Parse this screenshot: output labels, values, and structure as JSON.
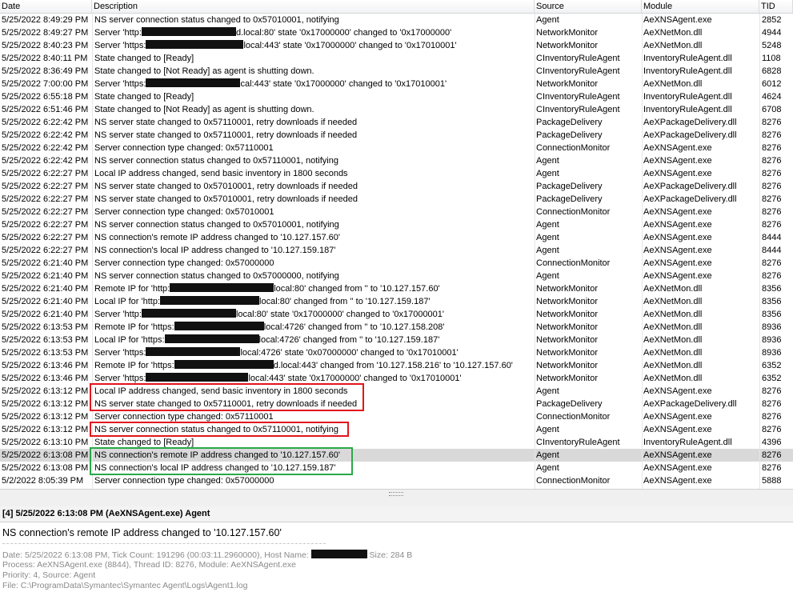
{
  "columns": {
    "date": "Date",
    "description": "Description",
    "source": "Source",
    "module": "Module",
    "tid": "TID"
  },
  "rows": [
    {
      "date": "5/25/2022 8:49:29 PM",
      "desc": [
        "NS server connection status changed to 0x57010001, notifying"
      ],
      "source": "Agent",
      "module": "AeXNSAgent.exe",
      "tid": "2852"
    },
    {
      "date": "5/25/2022 8:49:27 PM",
      "desc": [
        "Server 'http:",
        "#R#118",
        "d.local:80' state '0x17000000' changed to '0x17000000'"
      ],
      "source": "NetworkMonitor",
      "module": "AeXNetMon.dll",
      "tid": "4944"
    },
    {
      "date": "5/25/2022 8:40:23 PM",
      "desc": [
        "Server 'https:",
        "#R#122",
        "local:443' state '0x17000000' changed to '0x17010001'"
      ],
      "source": "NetworkMonitor",
      "module": "AeXNetMon.dll",
      "tid": "5248"
    },
    {
      "date": "5/25/2022 8:40:11 PM",
      "desc": [
        "State changed to [Ready]"
      ],
      "source": "CInventoryRuleAgent",
      "module": "InventoryRuleAgent.dll",
      "tid": "1108"
    },
    {
      "date": "5/25/2022 8:36:49 PM",
      "desc": [
        "State changed to [Not Ready] as agent is shutting down."
      ],
      "source": "CInventoryRuleAgent",
      "module": "InventoryRuleAgent.dll",
      "tid": "6828"
    },
    {
      "date": "5/25/2022 7:00:00 PM",
      "desc": [
        "Server 'https:",
        "#R#118",
        "cal:443' state '0x17000000' changed to '0x17010001'"
      ],
      "source": "NetworkMonitor",
      "module": "AeXNetMon.dll",
      "tid": "6012"
    },
    {
      "date": "5/25/2022 6:55:18 PM",
      "desc": [
        "State changed to [Ready]"
      ],
      "source": "CInventoryRuleAgent",
      "module": "InventoryRuleAgent.dll",
      "tid": "4624"
    },
    {
      "date": "5/25/2022 6:51:46 PM",
      "desc": [
        "State changed to [Not Ready] as agent is shutting down."
      ],
      "source": "CInventoryRuleAgent",
      "module": "InventoryRuleAgent.dll",
      "tid": "6708"
    },
    {
      "date": "5/25/2022 6:22:42 PM",
      "desc": [
        "NS server state changed to 0x57110001, retry downloads if needed"
      ],
      "source": "PackageDelivery",
      "module": "AeXPackageDelivery.dll",
      "tid": "8276"
    },
    {
      "date": "5/25/2022 6:22:42 PM",
      "desc": [
        "NS server state changed to 0x57110001, retry downloads if needed"
      ],
      "source": "PackageDelivery",
      "module": "AeXPackageDelivery.dll",
      "tid": "8276"
    },
    {
      "date": "5/25/2022 6:22:42 PM",
      "desc": [
        "Server connection type changed: 0x57110001"
      ],
      "source": "ConnectionMonitor",
      "module": "AeXNSAgent.exe",
      "tid": "8276"
    },
    {
      "date": "5/25/2022 6:22:42 PM",
      "desc": [
        "NS server connection status changed to 0x57110001, notifying"
      ],
      "source": "Agent",
      "module": "AeXNSAgent.exe",
      "tid": "8276"
    },
    {
      "date": "5/25/2022 6:22:27 PM",
      "desc": [
        "Local IP address changed, send basic inventory in 1800 seconds"
      ],
      "source": "Agent",
      "module": "AeXNSAgent.exe",
      "tid": "8276"
    },
    {
      "date": "5/25/2022 6:22:27 PM",
      "desc": [
        "NS server state changed to 0x57010001, retry downloads if needed"
      ],
      "source": "PackageDelivery",
      "module": "AeXPackageDelivery.dll",
      "tid": "8276"
    },
    {
      "date": "5/25/2022 6:22:27 PM",
      "desc": [
        "NS server state changed to 0x57010001, retry downloads if needed"
      ],
      "source": "PackageDelivery",
      "module": "AeXPackageDelivery.dll",
      "tid": "8276"
    },
    {
      "date": "5/25/2022 6:22:27 PM",
      "desc": [
        "Server connection type changed: 0x57010001"
      ],
      "source": "ConnectionMonitor",
      "module": "AeXNSAgent.exe",
      "tid": "8276"
    },
    {
      "date": "5/25/2022 6:22:27 PM",
      "desc": [
        "NS server connection status changed to 0x57010001, notifying"
      ],
      "source": "Agent",
      "module": "AeXNSAgent.exe",
      "tid": "8276"
    },
    {
      "date": "5/25/2022 6:22:27 PM",
      "desc": [
        "NS connection's remote IP address changed to '10.127.157.60'"
      ],
      "source": "Agent",
      "module": "AeXNSAgent.exe",
      "tid": "8444"
    },
    {
      "date": "5/25/2022 6:22:27 PM",
      "desc": [
        "NS connection's local IP address changed to '10.127.159.187'"
      ],
      "source": "Agent",
      "module": "AeXNSAgent.exe",
      "tid": "8444"
    },
    {
      "date": "5/25/2022 6:21:40 PM",
      "desc": [
        "Server connection type changed: 0x57000000"
      ],
      "source": "ConnectionMonitor",
      "module": "AeXNSAgent.exe",
      "tid": "8276"
    },
    {
      "date": "5/25/2022 6:21:40 PM",
      "desc": [
        "NS server connection status changed to 0x57000000, notifying"
      ],
      "source": "Agent",
      "module": "AeXNSAgent.exe",
      "tid": "8276"
    },
    {
      "date": "5/25/2022 6:21:40 PM",
      "desc": [
        "Remote IP for 'http:",
        "#R#130",
        "local:80' changed from '' to '10.127.157.60'"
      ],
      "source": "NetworkMonitor",
      "module": "AeXNetMon.dll",
      "tid": "8356"
    },
    {
      "date": "5/25/2022 6:21:40 PM",
      "desc": [
        "Local IP for 'http:",
        "#R#124",
        "local:80' changed from '' to '10.127.159.187'"
      ],
      "source": "NetworkMonitor",
      "module": "AeXNetMon.dll",
      "tid": "8356"
    },
    {
      "date": "5/25/2022 6:21:40 PM",
      "desc": [
        "Server 'http:",
        "#R#118",
        "local:80' state '0x17000000' changed to '0x17000001'"
      ],
      "source": "NetworkMonitor",
      "module": "AeXNetMon.dll",
      "tid": "8356"
    },
    {
      "date": "5/25/2022 6:13:53 PM",
      "desc": [
        "Remote IP for 'https:",
        "#R#112",
        "local:4726' changed from '' to '10.127.158.208'"
      ],
      "source": "NetworkMonitor",
      "module": "AeXNetMon.dll",
      "tid": "8936"
    },
    {
      "date": "5/25/2022 6:13:53 PM",
      "desc": [
        "Local IP for 'https:",
        "#R#118",
        "local:4726' changed from '' to '10.127.159.187'"
      ],
      "source": "NetworkMonitor",
      "module": "AeXNetMon.dll",
      "tid": "8936"
    },
    {
      "date": "5/25/2022 6:13:53 PM",
      "desc": [
        "Server 'https:",
        "#R#118",
        "local:4726' state '0x07000000' changed to '0x17010001'"
      ],
      "source": "NetworkMonitor",
      "module": "AeXNetMon.dll",
      "tid": "8936"
    },
    {
      "date": "5/25/2022 6:13:46 PM",
      "desc": [
        "Remote IP for 'https:",
        "#R#124",
        "d.local:443' changed from '10.127.158.216' to '10.127.157.60'"
      ],
      "source": "NetworkMonitor",
      "module": "AeXNetMon.dll",
      "tid": "6352"
    },
    {
      "date": "5/25/2022 6:13:46 PM",
      "desc": [
        "Server 'https:",
        "#R#128",
        "local:443' state '0x17000000' changed to '0x17010001'"
      ],
      "source": "NetworkMonitor",
      "module": "AeXNetMon.dll",
      "tid": "6352"
    },
    {
      "date": "5/25/2022 6:13:12 PM",
      "desc": [
        "Local IP address changed, send basic inventory in 1800 seconds"
      ],
      "source": "Agent",
      "module": "AeXNSAgent.exe",
      "tid": "8276"
    },
    {
      "date": "5/25/2022 6:13:12 PM",
      "desc": [
        "NS server state changed to 0x57110001, retry downloads if needed"
      ],
      "source": "PackageDelivery",
      "module": "AeXPackageDelivery.dll",
      "tid": "8276"
    },
    {
      "date": "5/25/2022 6:13:12 PM",
      "desc": [
        "Server connection type changed: 0x57110001"
      ],
      "source": "ConnectionMonitor",
      "module": "AeXNSAgent.exe",
      "tid": "8276"
    },
    {
      "date": "5/25/2022 6:13:12 PM",
      "desc": [
        "NS server connection status changed to 0x57110001, notifying"
      ],
      "source": "Agent",
      "module": "AeXNSAgent.exe",
      "tid": "8276"
    },
    {
      "date": "5/25/2022 6:13:10 PM",
      "desc": [
        "State changed to [Ready]"
      ],
      "source": "CInventoryRuleAgent",
      "module": "InventoryRuleAgent.dll",
      "tid": "4396"
    },
    {
      "date": "5/25/2022 6:13:08 PM",
      "desc": [
        "NS connection's remote IP address changed to '10.127.157.60'"
      ],
      "source": "Agent",
      "module": "AeXNSAgent.exe",
      "tid": "8276",
      "selected": true
    },
    {
      "date": "5/25/2022 6:13:08 PM",
      "desc": [
        "NS connection's local IP address changed to '10.127.159.187'"
      ],
      "source": "Agent",
      "module": "AeXNSAgent.exe",
      "tid": "8276"
    },
    {
      "date": "5/2/2022 8:05:39 PM",
      "desc": [
        "Server connection type changed: 0x57000000"
      ],
      "source": "ConnectionMonitor",
      "module": "AeXNSAgent.exe",
      "tid": "5888"
    }
  ],
  "highlights": [
    {
      "color": "red",
      "row_start": 29,
      "row_count": 2
    },
    {
      "color": "red",
      "row_start": 32,
      "row_count": 1
    },
    {
      "color": "green",
      "row_start": 34,
      "row_count": 2
    }
  ],
  "colors": {
    "highlight_red": "#e3141c",
    "highlight_green": "#2aa84a",
    "selected_row": "#d9d9d9"
  },
  "detail": {
    "title": "[4] 5/25/2022 6:13:08 PM (AeXNSAgent.exe) Agent",
    "message": "NS connection's remote IP address changed to '10.127.157.60'",
    "line1_a": "Date: 5/25/2022 6:13:08 PM, Tick Count: 191296 (00:03:11.2960000), Host Name: ",
    "line1_b": " Size: 284 B",
    "line2": "Process: AeXNSAgent.exe (8844), Thread ID: 8276, Module: AeXNSAgent.exe",
    "line3": "Priority: 4, Source: Agent",
    "line4": "File: C:\\ProgramData\\Symantec\\Symantec Agent\\Logs\\Agent1.log"
  }
}
